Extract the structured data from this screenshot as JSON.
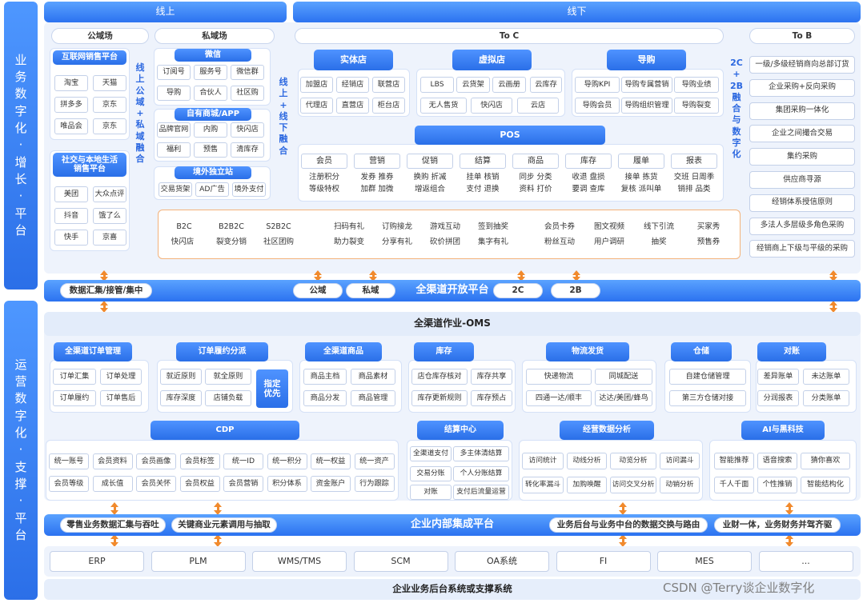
{
  "sidebar": {
    "top": "业\n务\n数\n字\n化\n·\n增\n长\n·\n平\n台",
    "bottom": "运\n营\n数\n字\n化\n·\n支\n撑\n·\n平\n台"
  },
  "top_tabs": {
    "online": "线上",
    "offline": "线下"
  },
  "online": {
    "public": {
      "title": "公域场",
      "internet": {
        "title": "互联网销售平台",
        "items": [
          "淘宝",
          "天猫",
          "拼多多",
          "京东",
          "唯品会",
          "京东"
        ]
      },
      "social": {
        "title": "社交与本地生活\n销售平台",
        "items": [
          "美团",
          "大众点评",
          "抖音",
          "饿了么",
          "快手",
          "京喜"
        ]
      },
      "fusion": "线\n上\n公\n域\n+\n私\n域\n融\n合"
    },
    "private": {
      "title": "私域场",
      "wechat": {
        "title": "微信",
        "items": [
          "订阅号",
          "服务号",
          "微信群",
          "导购",
          "合伙人",
          "社区购"
        ]
      },
      "mall": {
        "title": "自有商城/APP",
        "items": [
          "品牌官网",
          "内购",
          "快闪店",
          "福利",
          "预售",
          "清库存"
        ]
      },
      "intl": {
        "title": "境外独立站",
        "items": [
          "交易货架",
          "AD广告",
          "境外支付"
        ]
      }
    },
    "ol_fusion": "线\n上\n+\n线\n下\n融\n合"
  },
  "offline": {
    "toc": "To C",
    "tob": "To B",
    "store": {
      "title": "实体店",
      "items": [
        "加盟店",
        "经销店",
        "联营店",
        "代理店",
        "直营店",
        "柜台店"
      ]
    },
    "virtual": {
      "title": "虚拟店",
      "items": [
        "LBS",
        "云货架",
        "云画册",
        "云库存",
        "无人售货",
        "快闪店",
        "云店"
      ]
    },
    "guide": {
      "title": "导购",
      "items": [
        "导购KPI",
        "导购专属营销",
        "导购业绩",
        "导购会员",
        "导购组织管理",
        "导购裂变"
      ]
    },
    "pos": {
      "title": "POS",
      "tabs": [
        "会员",
        "营销",
        "促销",
        "结算",
        "商品",
        "库存",
        "履单",
        "报表"
      ],
      "subs": [
        "注册积分",
        "发券 推券",
        "换购 折减",
        "挂单 核销",
        "同步 分类",
        "收退 盘损",
        "接单 拣货",
        "交班 日周季",
        "等级特权",
        "加群 加微",
        "增返组合",
        "支付 退换",
        "资料 打价",
        "要调 查库",
        "复核 派叫单",
        "销排 品类"
      ]
    },
    "promo": [
      "B2C",
      "B2B2C",
      "S2B2C",
      "快闪店",
      "裂变分销",
      "社区团购",
      "扫码有礼",
      "订购接龙",
      "游戏互动",
      "签到抽奖",
      "助力裂变",
      "分享有礼",
      "砍价拼团",
      "集字有礼",
      "会员卡券",
      "图文视频",
      "线下引流",
      "买家秀",
      "粉丝互动",
      "用户调研",
      "抽奖",
      "预售券"
    ],
    "b2c_label": "2C\n+\n2B\n融\n合\n与\n数\n字\n化",
    "tob_items": [
      "一级/多级经销商向总部订货",
      "企业采购+反向采购",
      "集团采购一体化",
      "企业之间撮合交易",
      "集约采购",
      "供应商寻源",
      "经销体系授信原则",
      "多法人多层级多角色采购",
      "经销商上下级与平级的采购"
    ]
  },
  "open_platform": {
    "title": "全渠道开放平台",
    "left": "数据汇集/接管/集中",
    "pills": [
      "公域",
      "私域",
      "2C",
      "2B"
    ]
  },
  "oms": {
    "title": "全渠道作业-OMS",
    "mods": [
      {
        "title": "全渠道订单管理",
        "items": [
          "订单汇集",
          "订单处理",
          "订单履约",
          "订单售后"
        ]
      },
      {
        "title": "订单履约分派",
        "items": [
          "就近原则",
          "就全原则",
          "库存深度",
          "店铺负载"
        ],
        "extra": "指定\n优先"
      },
      {
        "title": "全渠道商品",
        "items": [
          "商品主档",
          "商品素材",
          "商品分发",
          "商品管理"
        ]
      },
      {
        "title": "库存",
        "items": [
          "店仓库存核对",
          "库存共享",
          "库存更新规则",
          "库存预占"
        ]
      },
      {
        "title": "物流发货",
        "items": [
          "快递物流",
          "同城配送",
          "四通一达/顺丰",
          "达达/美团/蜂鸟"
        ]
      },
      {
        "title": "仓储",
        "items": [
          "自建仓储管理",
          "第三方仓储对接"
        ]
      },
      {
        "title": "对账",
        "items": [
          "差异账单",
          "未达账单",
          "分润报表",
          "分类账单"
        ]
      }
    ]
  },
  "cdp": {
    "title": "CDP",
    "items": [
      "统一账号",
      "会员资料",
      "会员画像",
      "会员标签",
      "统一ID",
      "统一积分",
      "统一权益",
      "统一资产",
      "会员等级",
      "成长值",
      "会员关怀",
      "会员权益",
      "会员营销",
      "积分体系",
      "资金账户",
      "行为跟踪"
    ]
  },
  "settle": {
    "title": "结算中心",
    "items": [
      "全渠道支付",
      "多主体清结算",
      "交易分账",
      "个人分账结算",
      "对账",
      "支付后流量运营"
    ]
  },
  "analysis": {
    "title": "经营数据分析",
    "items": [
      "访问统计",
      "动线分析",
      "动览分析",
      "访问漏斗",
      "转化率漏斗",
      "加购唤醒",
      "访问交叉分析",
      "动销分析"
    ]
  },
  "ai": {
    "title": "AI与黑科技",
    "items": [
      "智能推荐",
      "语音搜索",
      "猜你喜欢",
      "千人千面",
      "个性推销",
      "智能结构化"
    ]
  },
  "integ": {
    "title": "企业内部集成平台",
    "left1": "零售业务数据汇集与吞吐",
    "left2": "关键商业元素调用与抽取",
    "right1": "业务后台与业务中台的数据交换与路由",
    "right2": "业财一体，业务财务并驾齐驱"
  },
  "systems": [
    "ERP",
    "PLM",
    "WMS/TMS",
    "SCM",
    "OA系统",
    "FI",
    "MES",
    "..."
  ],
  "footer": "企业业务后台系统或支撑系统",
  "watermark": "CSDN @Terry谈企业数字化"
}
